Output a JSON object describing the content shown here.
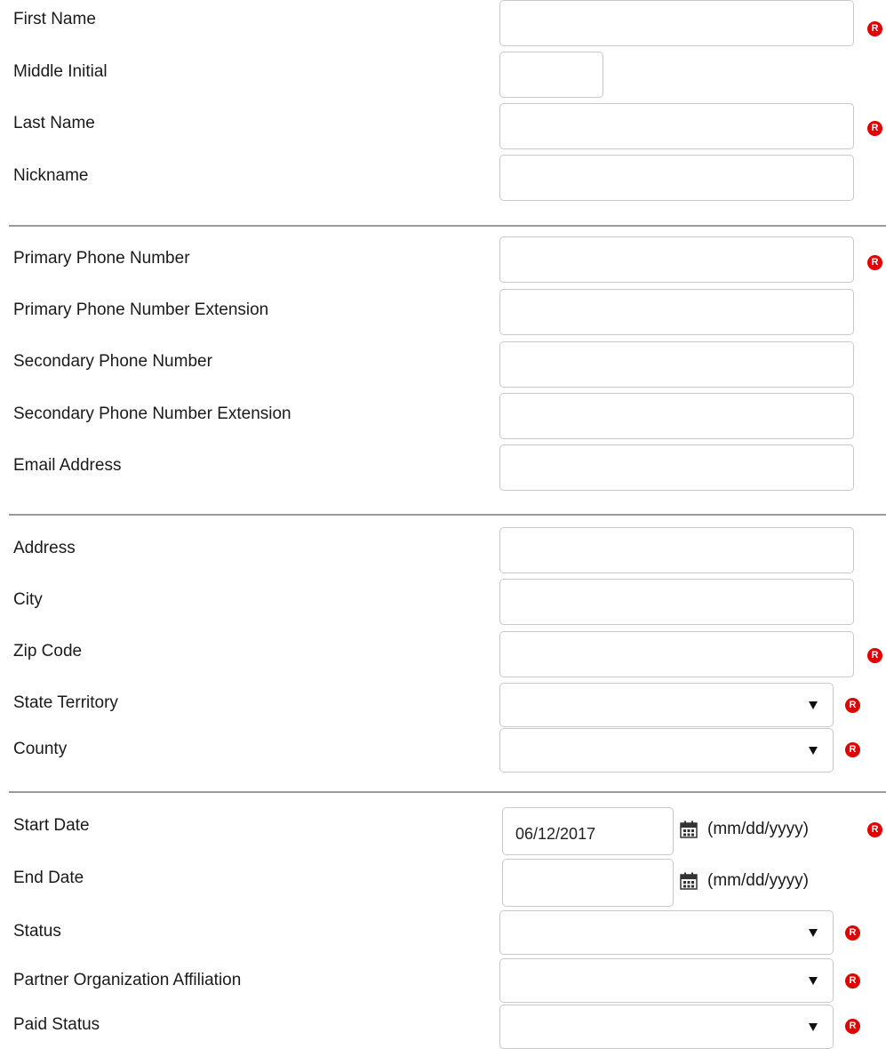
{
  "sections": {
    "name": {
      "first_name": {
        "label": "First Name",
        "value": ""
      },
      "middle_initial": {
        "label": "Middle Initial",
        "value": ""
      },
      "last_name": {
        "label": "Last Name",
        "value": ""
      },
      "nickname": {
        "label": "Nickname",
        "value": ""
      }
    },
    "contact": {
      "primary_phone": {
        "label": "Primary Phone Number",
        "value": ""
      },
      "primary_phone_ext": {
        "label": "Primary Phone Number Extension",
        "value": ""
      },
      "secondary_phone": {
        "label": "Secondary Phone Number",
        "value": ""
      },
      "secondary_phone_ext": {
        "label": "Secondary Phone Number Extension",
        "value": ""
      },
      "email": {
        "label": "Email Address",
        "value": ""
      }
    },
    "address": {
      "address": {
        "label": "Address",
        "value": ""
      },
      "city": {
        "label": "City",
        "value": ""
      },
      "zip": {
        "label": "Zip Code",
        "value": ""
      },
      "state": {
        "label": "State Territory",
        "selected": ""
      },
      "county": {
        "label": "County",
        "selected": ""
      }
    },
    "status": {
      "start_date": {
        "label": "Start Date",
        "value": "06/12/2017",
        "format": "(mm/dd/yyyy)"
      },
      "end_date": {
        "label": "End Date",
        "value": "",
        "format": "(mm/dd/yyyy)"
      },
      "status": {
        "label": "Status",
        "selected": ""
      },
      "partner_org": {
        "label": "Partner Organization Affiliation",
        "selected": ""
      },
      "paid_status": {
        "label": "Paid Status",
        "selected": ""
      }
    }
  },
  "required_marker": "R",
  "icons": {
    "required": "required-icon",
    "calendar": "calendar-icon",
    "dropdown": "chevron-down-icon"
  },
  "colors": {
    "required_badge": "#e00000",
    "divider": "#9a9a9a",
    "field_border": "#c9c9c9"
  }
}
